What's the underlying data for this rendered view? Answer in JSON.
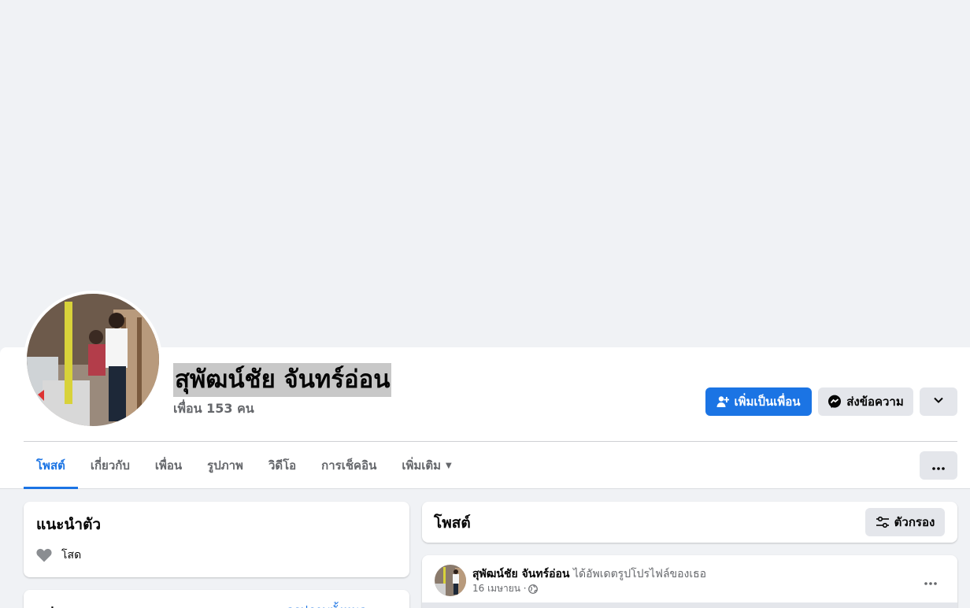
{
  "profile": {
    "name": "สุพัฒน์ชัย จันทร์อ่อน",
    "friends": "เพื่อน 153 คน"
  },
  "actions": {
    "add_friend": "เพิ่มเป็นเพื่อน",
    "message": "ส่งข้อความ"
  },
  "tabs": [
    {
      "label": "โพสต์"
    },
    {
      "label": "เกี่ยวกับ"
    },
    {
      "label": "เพื่อน"
    },
    {
      "label": "รูปภาพ"
    },
    {
      "label": "วิดีโอ"
    },
    {
      "label": "การเช็คอิน"
    },
    {
      "label": "เพิ่มเติม"
    }
  ],
  "intro": {
    "title": "แนะนำตัว",
    "relationship": "โสด"
  },
  "photos_card": {
    "title": "รูปภาพ",
    "link": "ดูรูปภาพทั้งหมด"
  },
  "posts": {
    "title": "โพสต์",
    "filter": "ตัวกรอง",
    "items": [
      {
        "author": "สุพัฒน์ชัย จันทร์อ่อน",
        "action": "ได้อัพเดตรูปโปรไฟล์ของเธอ",
        "date": "16 เมษายน ·"
      }
    ]
  },
  "colors": {
    "accent": "#1b74e4",
    "background": "#f0f2f5",
    "secondary_button": "#e4e6eb",
    "muted_text": "#65676b"
  },
  "icons": [
    "add-friend-icon",
    "messenger-icon",
    "chevron-down-icon",
    "more-dots-icon",
    "heart-icon",
    "filter-icon",
    "globe-icon",
    "caret-down-icon"
  ]
}
